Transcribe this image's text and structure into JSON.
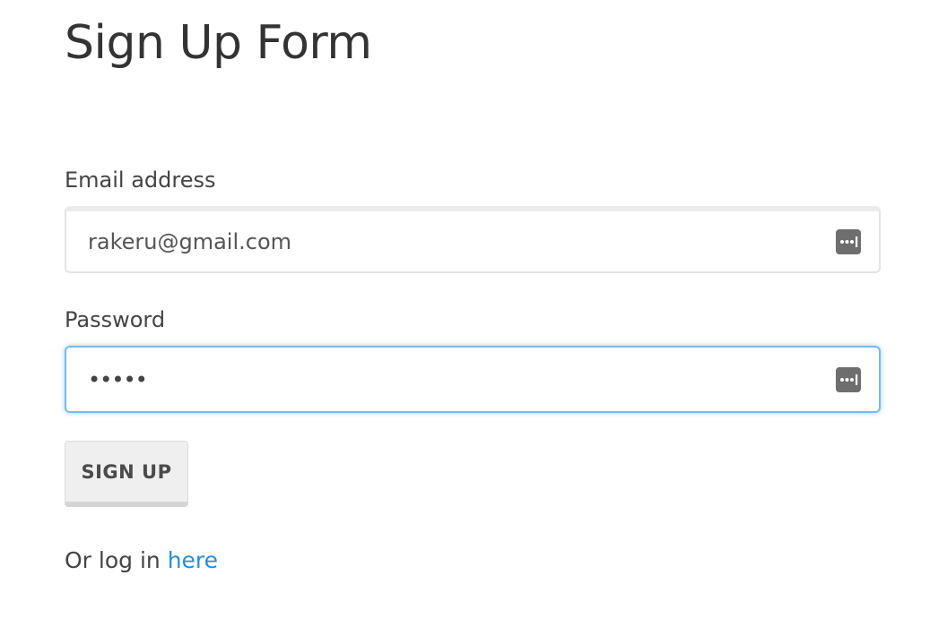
{
  "form": {
    "title": "Sign Up Form",
    "email": {
      "label": "Email address",
      "value": "rakeru@gmail.com",
      "icon": "password-manager-icon"
    },
    "password": {
      "label": "Password",
      "value": "•••••",
      "icon": "password-manager-icon",
      "focused": true
    },
    "submit_label": "SIGN UP",
    "login_prefix": "Or log in ",
    "login_link_text": "here"
  },
  "colors": {
    "link": "#2b8ed0",
    "focus_border": "#7db9e8",
    "button_bg": "#efefef"
  }
}
